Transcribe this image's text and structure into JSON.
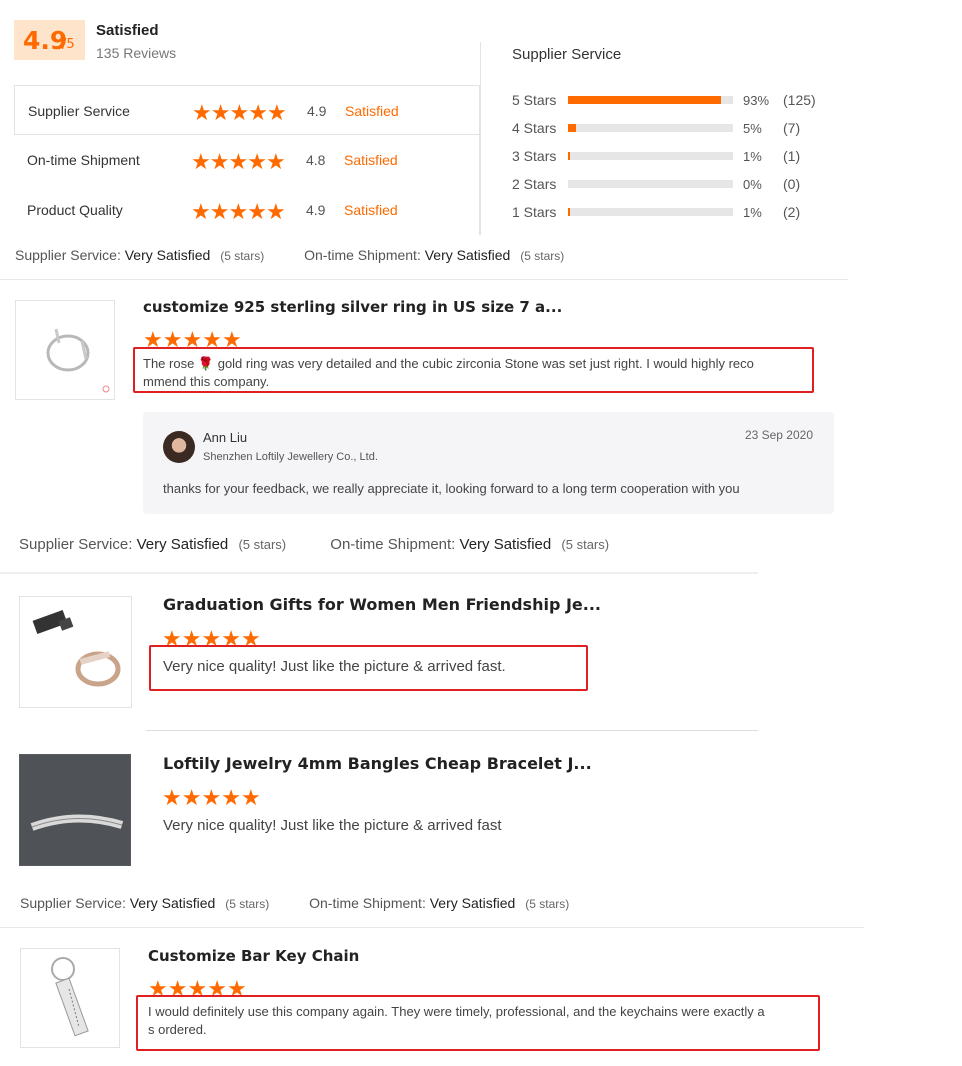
{
  "summary": {
    "score": "4.9",
    "score_of": "/5",
    "status": "Satisfied",
    "reviews": "135 Reviews"
  },
  "ratings": [
    {
      "label": "Supplier Service",
      "score": "4.9",
      "status": "Satisfied"
    },
    {
      "label": "On-time Shipment",
      "score": "4.8",
      "status": "Satisfied"
    },
    {
      "label": "Product Quality",
      "score": "4.9",
      "status": "Satisfied"
    }
  ],
  "distribution": {
    "title": "Supplier Service",
    "rows": [
      {
        "label": "5  Stars",
        "fraction": 0.93,
        "pct": "93%",
        "count": "(125)"
      },
      {
        "label": "4  Stars",
        "fraction": 0.05,
        "pct": "5%",
        "count": "(7)"
      },
      {
        "label": "3  Stars",
        "fraction": 0.01,
        "pct": "1%",
        "count": "(1)"
      },
      {
        "label": "2  Stars",
        "fraction": 0.0,
        "pct": "0%",
        "count": "(0)"
      },
      {
        "label": "1  Stars",
        "fraction": 0.01,
        "pct": "1%",
        "count": "(2)"
      }
    ]
  },
  "star_glyph": "★",
  "service_lines": [
    {
      "s_label": "Supplier Service:",
      "s_value": "Very Satisfied",
      "s_stars": "(5 stars)",
      "o_label": "On-time Shipment:",
      "o_value": "Very Satisfied",
      "o_stars": "(5 stars)"
    },
    {
      "s_label": "Supplier Service:",
      "s_value": "Very Satisfied",
      "s_stars": "(5 stars)",
      "o_label": "On-time Shipment:",
      "o_value": "Very Satisfied",
      "o_stars": "(5 stars)"
    },
    {
      "s_label": "Supplier Service:",
      "s_value": "Very Satisfied",
      "s_stars": "(5 stars)",
      "o_label": "On-time Shipment:",
      "o_value": "Very Satisfied",
      "o_stars": "(5 stars)"
    }
  ],
  "reviews": [
    {
      "title": "customize 925 sterling silver ring in US size 7 a...",
      "rating": 5,
      "text_1": "The rose 🌹 gold ring was very detailed and the cubic zirconia Stone was set just right.  I would highly reco",
      "text_2": "mmend this company."
    },
    {
      "title": "Graduation Gifts for Women Men Friendship Je...",
      "rating": 5,
      "text_1": "Very nice quality! Just like the picture & arrived fast."
    },
    {
      "title": "Loftily Jewelry 4mm Bangles Cheap Bracelet J...",
      "rating": 5,
      "text_1": "Very nice quality! Just like the picture & arrived fast"
    },
    {
      "title": "Customize Bar Key Chain",
      "rating": 5,
      "text_1": "I would definitely use this company again. They were timely, professional, and the keychains were exactly a",
      "text_2": "s ordered."
    }
  ],
  "reply": {
    "name": "Ann Liu",
    "company": "Shenzhen Loftily Jewellery Co., Ltd.",
    "date": "23 Sep 2020",
    "text": "thanks for your feedback, we really appreciate it, looking forward to a long term cooperation with you"
  },
  "colors": {
    "accent": "#ff6a00",
    "highlight_box": "#e02020"
  }
}
